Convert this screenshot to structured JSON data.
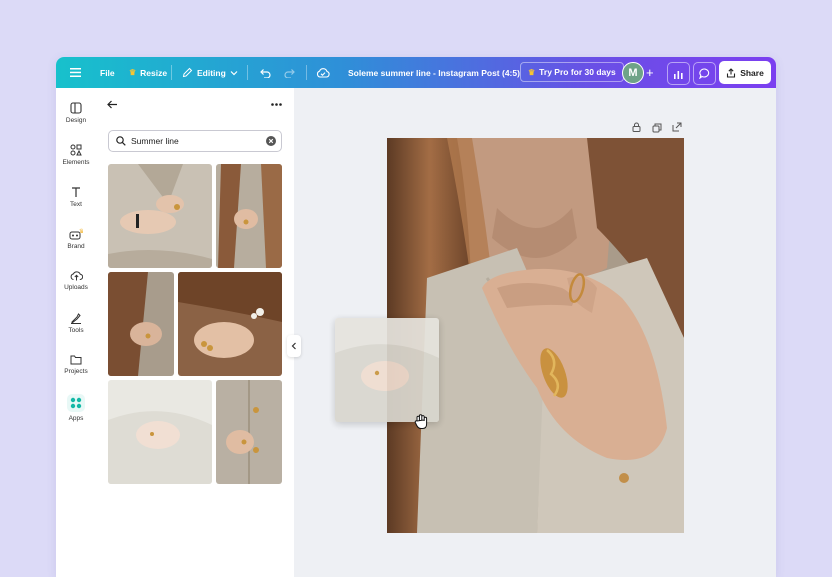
{
  "topbar": {
    "file_label": "File",
    "resize_label": "Resize",
    "editing_label": "Editing",
    "doc_title": "Soleme summer line - Instagram Post (4:5)",
    "pro_label": "Try Pro for 30 days",
    "avatar_initial": "M",
    "share_label": "Share"
  },
  "rail": {
    "items": [
      {
        "label": "Design",
        "icon": "layout-icon"
      },
      {
        "label": "Elements",
        "icon": "shapes-icon"
      },
      {
        "label": "Text",
        "icon": "text-icon"
      },
      {
        "label": "Brand",
        "icon": "brand-icon"
      },
      {
        "label": "Uploads",
        "icon": "cloud-upload-icon"
      },
      {
        "label": "Tools",
        "icon": "tools-icon"
      },
      {
        "label": "Projects",
        "icon": "folder-icon"
      },
      {
        "label": "Apps",
        "icon": "apps-icon"
      }
    ]
  },
  "panel": {
    "search_value": "Summer line"
  },
  "colors": {
    "accent": "#7b3ff0",
    "teal": "#17c1cc",
    "background": "#dcdaf7"
  }
}
